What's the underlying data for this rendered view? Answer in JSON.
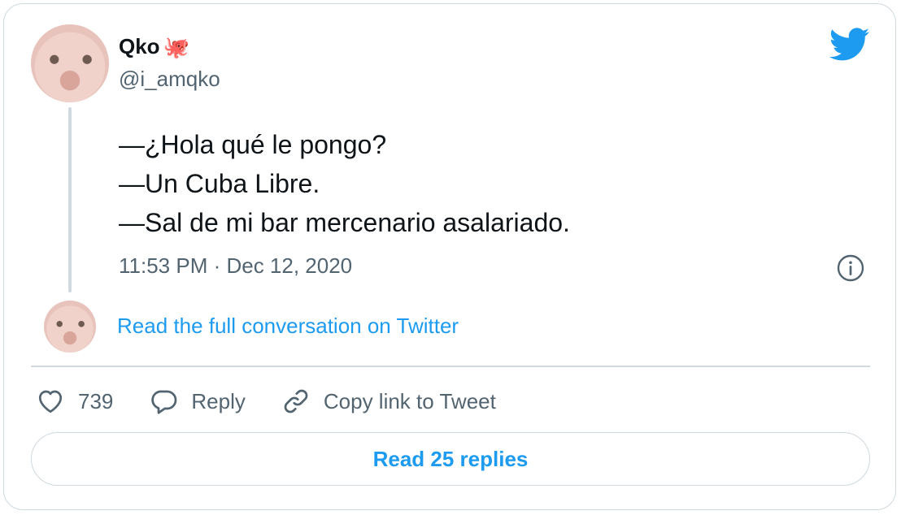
{
  "author": {
    "display_name": "Qko",
    "emoji": "🐙",
    "handle": "@i_amqko"
  },
  "tweet": {
    "lines": [
      "—¿Hola qué le pongo?",
      "—Un Cuba Libre.",
      "—Sal de mi bar mercenario asalariado."
    ],
    "timestamp": "11:53 PM · Dec 12, 2020"
  },
  "links": {
    "read_full": "Read the full conversation on Twitter"
  },
  "actions": {
    "like_count": "739",
    "reply_label": "Reply",
    "copy_label": "Copy link to Tweet"
  },
  "footer": {
    "read_replies": "Read 25 replies"
  },
  "colors": {
    "accent": "#1d9bf0",
    "text": "#0f1419",
    "muted": "#536471",
    "border": "#cfd9de"
  },
  "icons": [
    "twitter-bird-icon",
    "info-icon",
    "heart-icon",
    "reply-bubble-icon",
    "link-icon",
    "octopus-emoji"
  ]
}
